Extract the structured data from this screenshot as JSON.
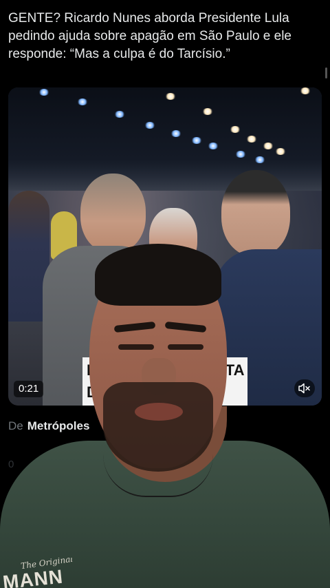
{
  "post": {
    "text": "GENTE? Ricardo Nunes aborda Presidente Lula pedindo ajuda sobre apagão em São Paulo e ele responde: “Mas a culpa é do Tarcísio.”"
  },
  "video": {
    "duration": "0:21",
    "caption_fragments": [
      "L",
      "LTA",
      "D"
    ],
    "mute_icon": "speaker-muted-icon"
  },
  "source": {
    "prefix": "De",
    "name": "Metrópoles"
  },
  "faded": {
    "text": "0"
  },
  "shirt_print": {
    "script": "The Original",
    "block": "MANN"
  },
  "colors": {
    "background": "#000000",
    "text_primary": "#e7e9ea",
    "text_secondary": "#71767b"
  }
}
